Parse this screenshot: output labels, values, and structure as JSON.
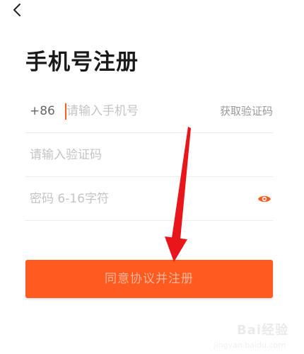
{
  "nav": {
    "back_icon": "chevron-left-icon"
  },
  "page": {
    "title": "手机号注册"
  },
  "phone": {
    "country_code": "+86",
    "placeholder": "请输入手机号",
    "get_code_label": "获取验证码"
  },
  "code": {
    "placeholder": "请输入验证码"
  },
  "password": {
    "placeholder": "密码 6-16字符",
    "toggle_icon": "eye-icon"
  },
  "submit": {
    "label": "同意协议并注册"
  },
  "annotation": {
    "arrow_icon": "red-arrow-icon"
  },
  "watermark": {
    "text": "Bai经验",
    "sub": "jingyan.baidu.com"
  },
  "colors": {
    "accent": "#ff5a1f",
    "button_text": "#ffb59a",
    "arrow": "#e8151b"
  }
}
